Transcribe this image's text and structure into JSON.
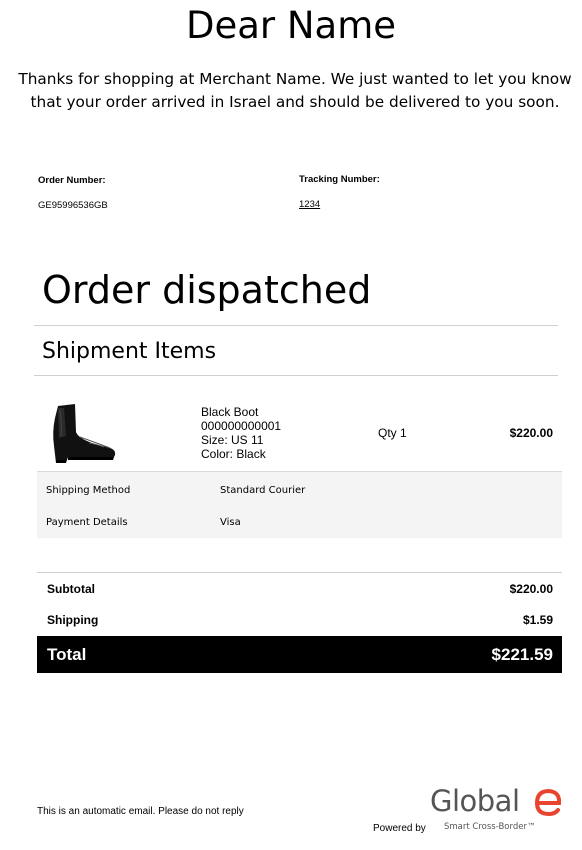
{
  "email": {
    "greeting": "Dear Name",
    "intro": "Thanks for shopping at Merchant Name. We just wanted to let you know that your order arrived in Israel and should be delivered to you soon."
  },
  "order": {
    "number_label": "Order Number:",
    "number_value": "GE95996536GB",
    "tracking_label": "Tracking Number:",
    "tracking_value": "1234"
  },
  "status": {
    "heading": "Order dispatched"
  },
  "shipment": {
    "heading": "Shipment Items",
    "item": {
      "name": "Black Boot",
      "sku": "000000000001",
      "size": "Size: US 11",
      "color": "Color: Black",
      "qty": "Qty 1",
      "price": "$220.00",
      "image_icon": "black-chelsea-boot-icon"
    },
    "shipping_method_label": "Shipping Method",
    "shipping_method_value": "Standard Courier",
    "payment_label": "Payment Details",
    "payment_value": "Visa"
  },
  "summary": {
    "subtotal_label": "Subtotal",
    "subtotal_value": "$220.00",
    "shipping_label": "Shipping",
    "shipping_value": "$1.59",
    "total_label": "Total",
    "total_value": "$221.59"
  },
  "footer": {
    "note": "This is an automatic email. Please do not reply",
    "powered_by": "Powered by",
    "logo_text": "Global",
    "tagline": "Smart Cross-Border™"
  },
  "colors": {
    "brand_accent": "#e8442e",
    "total_bar": "#000000",
    "panel_bg": "#f4f4f4",
    "rule": "#cfcfcf"
  }
}
